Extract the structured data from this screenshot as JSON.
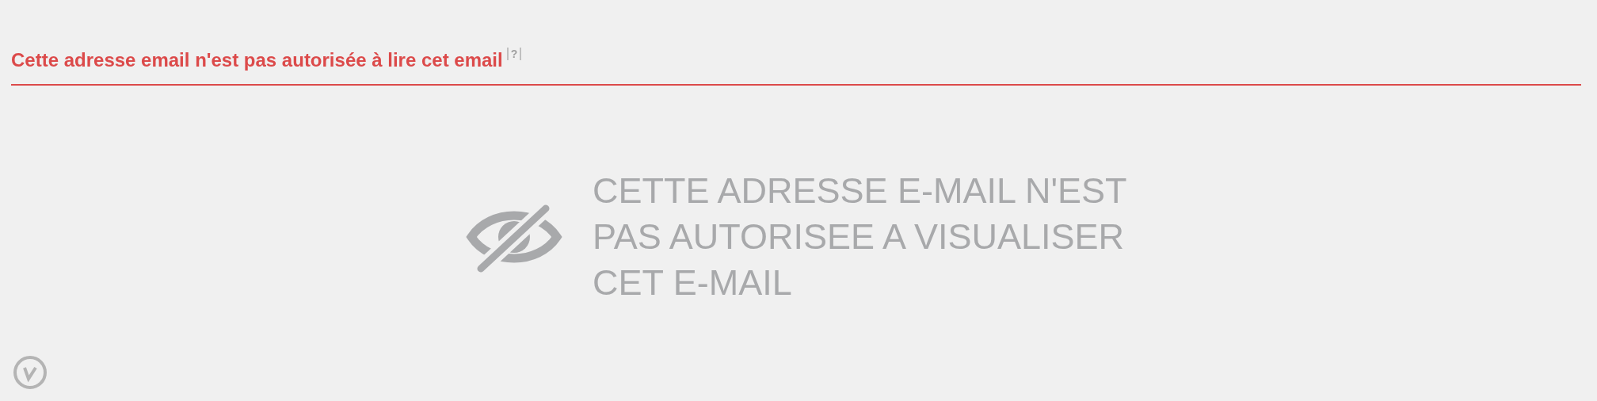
{
  "header": {
    "title": "Cette adresse email n'est pas autorisée à lire cet email",
    "help": "?"
  },
  "message": {
    "lines": [
      "CETTE ADRESSE E-MAIL N'EST",
      "PAS AUTORISEE A VISUALISER",
      "CET E-MAIL"
    ]
  }
}
